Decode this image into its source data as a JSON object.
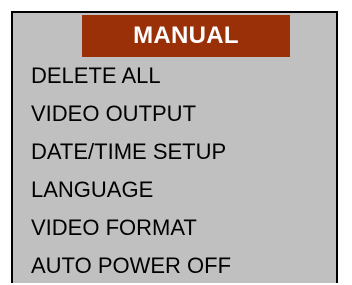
{
  "menu": {
    "title": "MANUAL",
    "title_bg": "#9a3008",
    "panel_bg": "#c0c0c0",
    "items": [
      {
        "label": "DELETE ALL"
      },
      {
        "label": "VIDEO OUTPUT"
      },
      {
        "label": "DATE/TIME SETUP"
      },
      {
        "label": "LANGUAGE"
      },
      {
        "label": "VIDEO FORMAT"
      },
      {
        "label": "AUTO POWER OFF"
      }
    ]
  }
}
